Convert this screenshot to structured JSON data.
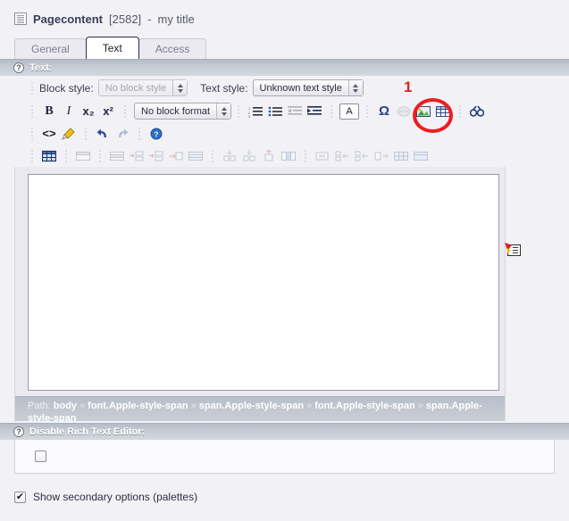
{
  "header": {
    "icon": "page-document-icon",
    "title": "Pagecontent",
    "id": "[2582]",
    "separator": "-",
    "subtitle": "my title"
  },
  "tabs": [
    {
      "label": "General",
      "active": false
    },
    {
      "label": "Text",
      "active": true
    },
    {
      "label": "Access",
      "active": false
    }
  ],
  "sections": {
    "text": {
      "help": "?",
      "title": "Text:"
    },
    "disable_rte": {
      "help": "?",
      "title": "Disable Rich Text Editor:"
    }
  },
  "styles_row": {
    "block_style_label": "Block style:",
    "block_style_value": "No block style",
    "text_style_label": "Text style:",
    "text_style_value": "Unknown text style"
  },
  "toolbar1": {
    "bold": "B",
    "italic": "I",
    "subscript": "x₂",
    "superscript": "x²",
    "block_format_value": "No block format",
    "ordered_list": "ordered-list-icon",
    "unordered_list": "unordered-list-icon",
    "outdent": "outdent-icon",
    "indent": "indent-icon",
    "text_color": "A",
    "special_char": "Ω",
    "link": "link-icon",
    "image": "image-icon",
    "table": "table-icon",
    "find": "find-replace-icon"
  },
  "toolbar2": {
    "source": "<>",
    "clean": "clean-format-icon",
    "undo": "undo-icon",
    "redo": "redo-icon",
    "help": "help-icon"
  },
  "toolbar3": {
    "items": [
      "insert-table-icon",
      "table-properties-icon",
      "row-properties-icon",
      "insert-row-before-icon",
      "insert-row-after-icon",
      "delete-row-icon",
      "merge-cells-icon",
      "split-cell-vertical-icon",
      "split-cell-horizontal-icon",
      "cell-properties-icon",
      "column-properties-icon",
      "delete-column-icon",
      "insert-column-before-icon",
      "insert-column-after-icon",
      "delete-table-icon",
      "table-grid-icon",
      "table-fill-icon"
    ]
  },
  "path": {
    "label": "Path:",
    "segments": [
      "body",
      "font.Apple-style-span",
      "span.Apple-style-span",
      "font.Apple-style-span",
      "span.Apple-style-span"
    ],
    "separator": "»"
  },
  "disable_rte_checkbox": {
    "checked": false,
    "mark": ""
  },
  "secondary_options": {
    "checked": true,
    "mark": "✔",
    "label": "Show secondary options (palettes)"
  },
  "annotation": {
    "number": "1",
    "target": "table-icon",
    "color": "#ee1c24"
  },
  "floating": {
    "icon": "pinned-note-icon"
  },
  "colors": {
    "page_bg": "#f2f2f6",
    "section_header": "#c6cbd4",
    "accent_red": "#ee1c24",
    "title_text": "#3c3c5a"
  }
}
